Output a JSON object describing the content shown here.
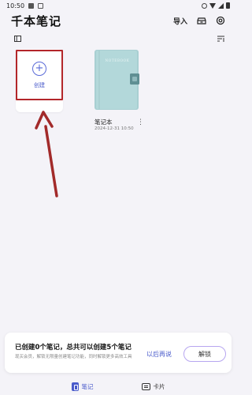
{
  "status_bar": {
    "time": "10:50"
  },
  "header": {
    "title": "千本笔记",
    "import_label": "导入"
  },
  "grid": {
    "create_card": {
      "label": "创建",
      "icon": "plus-icon"
    },
    "notebooks": [
      {
        "cover_text": "NOTEBOOK",
        "name": "笔记本",
        "date": "2024-12-31 10:50"
      }
    ]
  },
  "promo": {
    "title": "已创建0个笔记，总共可以创建5个笔记",
    "description": "现买会员，解锁无限量创建笔记功能，同时解锁更多高效工具",
    "later_label": "以后再说",
    "unlock_label": "解锁"
  },
  "bottom_nav": [
    {
      "label": "笔记",
      "active": true
    },
    {
      "label": "卡片",
      "active": false
    }
  ],
  "colors": {
    "accent": "#4a5bcb",
    "highlight": "#b3262a",
    "notebook": "#a8cfd2",
    "background": "#f4f3f8"
  }
}
